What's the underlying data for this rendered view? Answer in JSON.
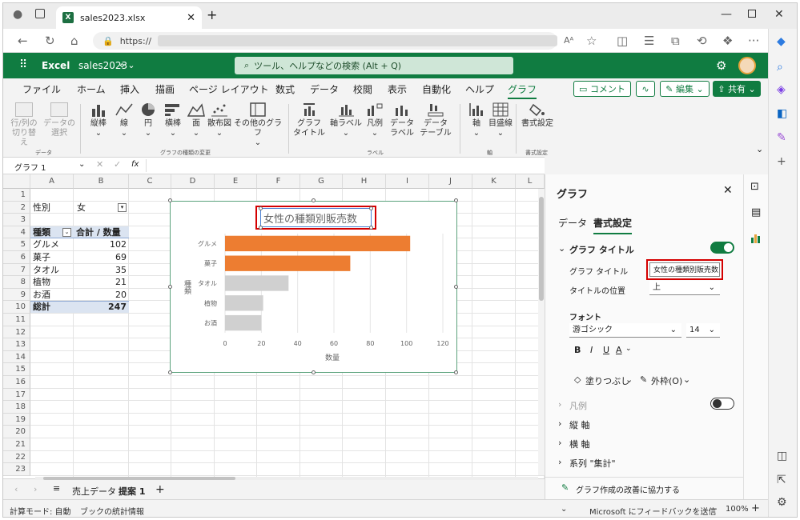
{
  "browser": {
    "tab_title": "sales2023.xlsx",
    "url_prefix": "https://",
    "reader_label": "Aᴬ"
  },
  "excel": {
    "app_name": "Excel",
    "file_name": "sales2023",
    "file_name_suffix": "⋄ ⌄",
    "search_placeholder": "ツール、ヘルプなどの検索 (Alt + Q)"
  },
  "menu": {
    "items": [
      "ファイル",
      "ホーム",
      "挿入",
      "描画",
      "ページ レイアウト",
      "数式",
      "データ",
      "校閲",
      "表示",
      "自動化",
      "ヘルプ",
      "グラフ"
    ],
    "comment": "コメント",
    "edit": "編集",
    "share": "共有"
  },
  "ribbon": {
    "switch_row_col": [
      "行/列の",
      "切り替え"
    ],
    "select_data": [
      "データの",
      "選択"
    ],
    "group_data": "データ",
    "vertical_bar": "縦棒",
    "line": "線",
    "pie": "円",
    "horizontal_bar": "横棒",
    "area": "面",
    "scatter": "散布図",
    "other_charts": "その他のグラフ",
    "group_chart_type": "グラフの種類の変更",
    "chart_title": [
      "グラフ",
      "タイトル"
    ],
    "axis_label": "軸ラベル",
    "legend": "凡例",
    "data_label": [
      "データ",
      "ラベル"
    ],
    "data_table": [
      "データ",
      "テーブル"
    ],
    "group_label": "ラベル",
    "axis": "軸",
    "gridlines": "目盛線",
    "group_axis": "軸",
    "format": "書式設定",
    "group_format": "書式設定"
  },
  "formula_bar": {
    "name_box": "グラフ 1",
    "fx": "fx"
  },
  "grid": {
    "columns": [
      "A",
      "B",
      "C",
      "D",
      "E",
      "F",
      "G",
      "H",
      "I",
      "J",
      "K",
      "L"
    ],
    "rows": [
      "1",
      "2",
      "3",
      "4",
      "5",
      "6",
      "7",
      "8",
      "9",
      "10",
      "11",
      "12",
      "13",
      "14",
      "15",
      "16",
      "17",
      "18",
      "19",
      "20",
      "21",
      "22",
      "23"
    ],
    "filter_label": "性別",
    "filter_value": "女",
    "header_type": "種類",
    "header_sum": "合計 / 数量",
    "data_rows": [
      {
        "type": "グルメ",
        "sum": "102"
      },
      {
        "type": "菓子",
        "sum": "69"
      },
      {
        "type": "タオル",
        "sum": "35"
      },
      {
        "type": "植物",
        "sum": "21"
      },
      {
        "type": "お酒",
        "sum": "20"
      }
    ],
    "total_label": "総計",
    "total_value": "247"
  },
  "chart_data": {
    "type": "bar",
    "orientation": "horizontal",
    "title": "女性の種類別販売数",
    "xlabel": "数量",
    "ylabel": "種類",
    "categories": [
      "グルメ",
      "菓子",
      "タオル",
      "植物",
      "お酒"
    ],
    "values": [
      102,
      69,
      35,
      21,
      20
    ],
    "highlight_colors": [
      "#ed7d31",
      "#ed7d31",
      "#d0d0d0",
      "#d0d0d0",
      "#d0d0d0"
    ],
    "xlim": [
      0,
      120
    ],
    "xticks": [
      "0",
      "20",
      "40",
      "60",
      "80",
      "100",
      "120"
    ],
    "grid": true,
    "legend": false
  },
  "sheets": {
    "tabs": [
      "売上データ",
      "提案 1"
    ],
    "active": "提案 1",
    "add": "+"
  },
  "status": {
    "mode": "計算モード: 自動",
    "stats": "ブックの統計情報",
    "feedback": "Microsoft にフィードバックを送信",
    "zoom": "100%",
    "minus": "−",
    "plus": "+"
  },
  "pane": {
    "title": "グラフ",
    "tab_data": "データ",
    "tab_format": "書式設定",
    "section_title": "グラフ タイトル",
    "field_title_label": "グラフ タイトル",
    "field_title_value": "女性の種類別販売数",
    "field_position_label": "タイトルの位置",
    "field_position_value": "上",
    "font_label": "フォント",
    "font_family": "游ゴシック",
    "font_size": "14",
    "bold": "B",
    "italic": "I",
    "underline": "U",
    "fontcolor": "A",
    "fill": "塗りつぶし",
    "outline": "外枠(O)",
    "legend": "凡例",
    "vaxis": "縦 軸",
    "haxis": "横 軸",
    "series": "系列 \"集計\"",
    "feedback": "グラフ作成の改善に協力する"
  },
  "colors": {
    "excel_green": "#107c41",
    "highlight_red": "#d40000",
    "bar_orange": "#ed7d31",
    "bar_gray": "#d0d0d0"
  }
}
